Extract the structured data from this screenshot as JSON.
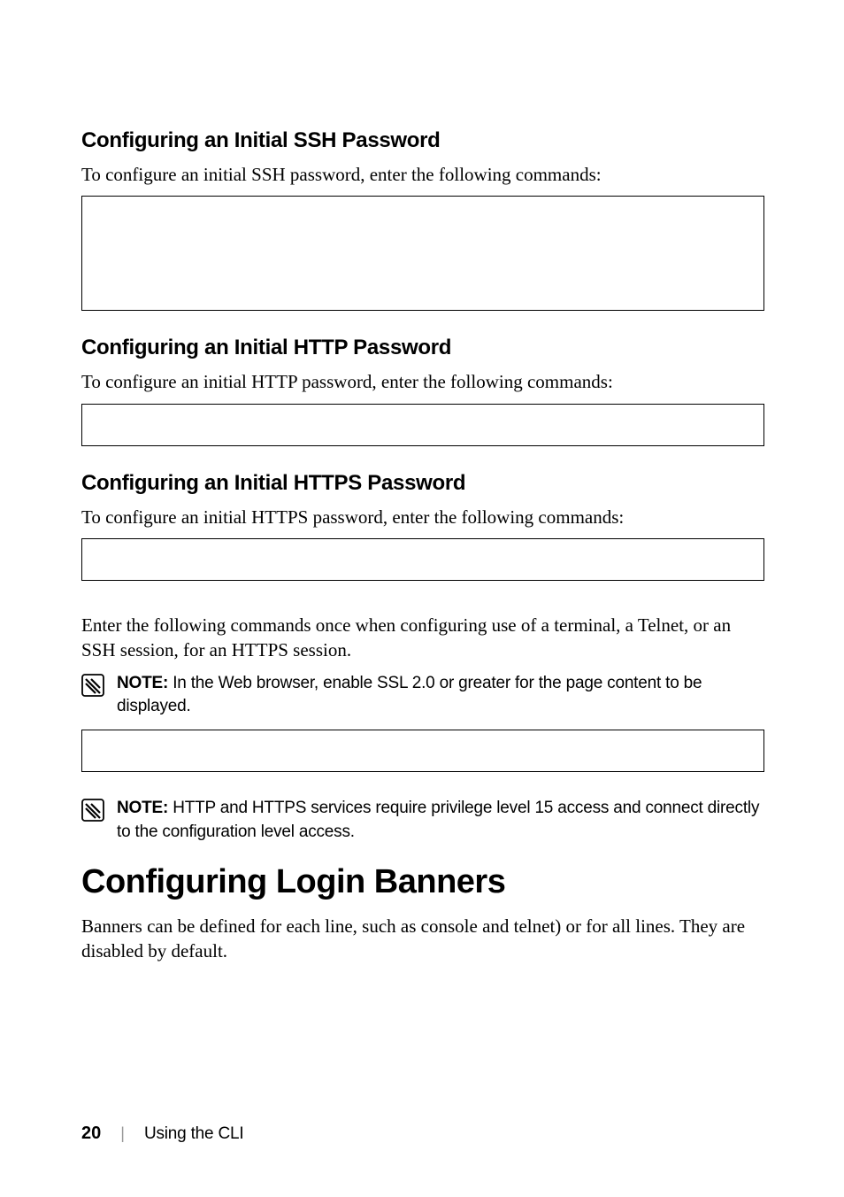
{
  "sections": {
    "ssh": {
      "heading": "Configuring an Initial SSH Password",
      "body": "To configure an initial SSH password, enter the following commands:"
    },
    "http": {
      "heading": "Configuring an Initial HTTP Password",
      "body": "To configure an initial HTTP password, enter the following commands:"
    },
    "https": {
      "heading": "Configuring an Initial HTTPS Password",
      "body": "To configure an initial HTTPS password, enter the following commands:",
      "afterbox": "Enter the following commands once when configuring use of a terminal, a Telnet, or an SSH session, for an HTTPS session."
    }
  },
  "notes": {
    "note1": {
      "label": "NOTE:",
      "text": " In the Web browser, enable SSL 2.0 or greater for the page content to be displayed."
    },
    "note2": {
      "label": "NOTE:",
      "text": " HTTP and HTTPS services require privilege level 15 access and connect directly to the configuration level access."
    }
  },
  "mainHeading": "Configuring Login Banners",
  "mainBody": "Banners can be defined for each line, such as console and telnet) or for all lines. They are disabled by default.",
  "footer": {
    "pageNum": "20",
    "separator": "|",
    "title": "Using the CLI"
  }
}
